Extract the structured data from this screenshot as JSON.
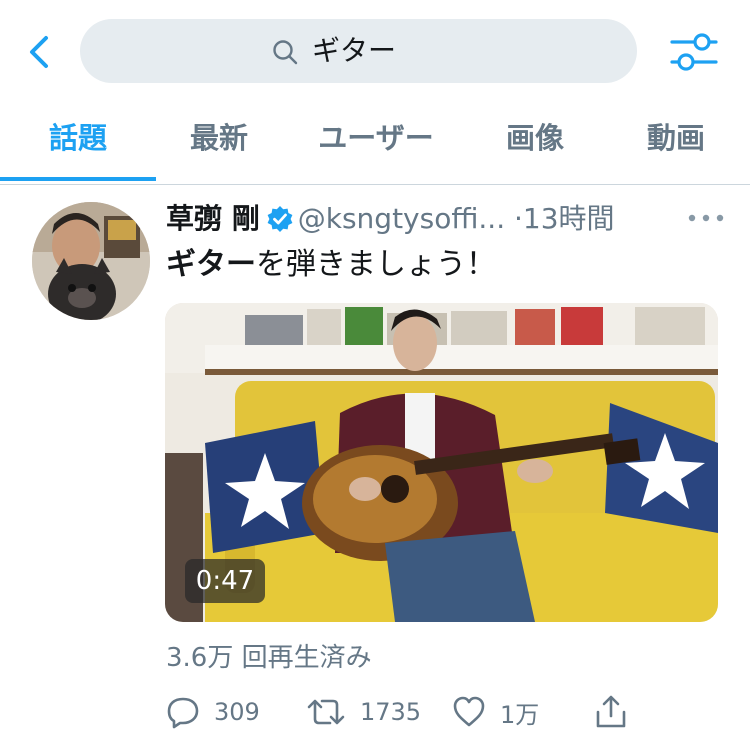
{
  "search": {
    "query": "ギター"
  },
  "tabs": [
    {
      "label": "話題",
      "active": true
    },
    {
      "label": "最新",
      "active": false
    },
    {
      "label": "ユーザー",
      "active": false
    },
    {
      "label": "画像",
      "active": false
    },
    {
      "label": "動画",
      "active": false
    }
  ],
  "tweet": {
    "name": "草彅 剛",
    "handle": "@ksngtysoffi...",
    "time": "·13時間",
    "text_highlight": "ギター",
    "text_rest": "を弾きましょう！",
    "video_duration": "0:47",
    "views": "3.6万 回再生済み",
    "actions": {
      "replies": "309",
      "retweets": "1735",
      "likes": "1万"
    }
  },
  "colors": {
    "accent": "#1da1f2",
    "secondary_text": "#657786",
    "search_bg": "#e6ecf0"
  },
  "icons": [
    "back-chevron-icon",
    "search-icon",
    "filter-sliders-icon",
    "verified-badge-icon",
    "more-icon",
    "reply-icon",
    "retweet-icon",
    "like-icon",
    "share-icon"
  ]
}
